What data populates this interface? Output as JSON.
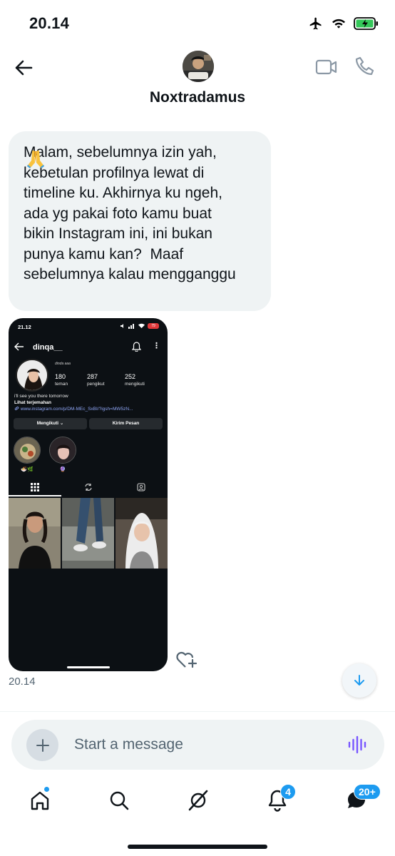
{
  "status_bar": {
    "time": "20.14",
    "icons": [
      "airplane-icon",
      "wifi-icon",
      "battery-charging-icon"
    ]
  },
  "header": {
    "contact_name": "Noxtradamus",
    "icons": [
      "back-arrow-icon",
      "video-call-icon",
      "phone-call-icon"
    ]
  },
  "message": {
    "text": "Malam, sebelumnya izin yah,\nkebetulan profilnya lewat di\ntimeline ku. Akhirnya ku ngeh,\nada yg pakai foto kamu buat\nbikin Instagram ini, ini bukan\npunya kamu kan?  Maaf\nsebelumnya kalau mengganggu",
    "emoji": "🙏",
    "time": "20.14"
  },
  "attachment": {
    "status_time": "21.12",
    "battery": "79",
    "username": "dinqa__",
    "fullname": "dinda aaa",
    "stats": [
      {
        "value": "180",
        "label": "teman"
      },
      {
        "value": "287",
        "label": "pengikut"
      },
      {
        "value": "252",
        "label": "mengikuti"
      }
    ],
    "bio": "i'll see you there tomorrow",
    "translate": "Lihat terjemahan",
    "link": "www.instagram.com/p/DM-MEc_SxBI/?igsh=MW5zN...",
    "follow_button": "Mengikuti ⌄",
    "message_button": "Kirim Pesan",
    "highlights": [
      {
        "label": "🍜🌿"
      },
      {
        "label": "🔮"
      }
    ]
  },
  "composer": {
    "placeholder": "Start a message"
  },
  "nav": {
    "notifications_badge": "4",
    "messages_badge": "20+"
  },
  "colors": {
    "accent": "#1d9bf0",
    "bubble": "#eff3f4",
    "voice": "#7856ff"
  }
}
